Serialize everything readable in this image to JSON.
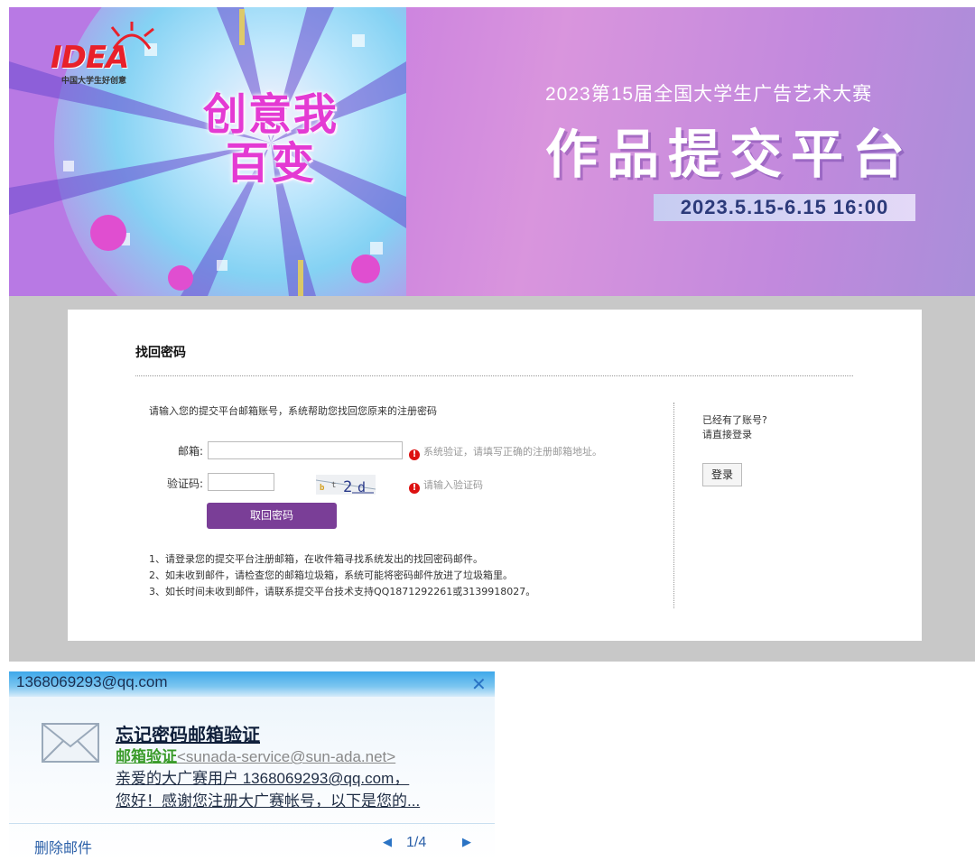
{
  "banner": {
    "logo_text": "IDEA",
    "logo_subtitle": "中国大学生好创意",
    "slogan_line1": "创意我",
    "slogan_line2": "百变",
    "contest_title": "2023第15届全国大学生广告艺术大赛",
    "platform_title": "作品提交平台",
    "date_range": "2023.5.15-6.15 16:00"
  },
  "reset": {
    "title": "找回密码",
    "intro": "请输入您的提交平台邮箱账号，系统帮助您找回您原来的注册密码",
    "email_label": "邮箱:",
    "email_hint": "系统验证，请填写正确的注册邮箱地址。",
    "captcha_label": "验证码:",
    "captcha_text": "b t 2 d",
    "captcha_hint": "请输入验证码",
    "submit_label": "取回密码",
    "notes": [
      "1、请登录您的提交平台注册邮箱，在收件箱寻找系统发出的找回密码邮件。",
      "2、如未收到邮件，请检查您的邮箱垃圾箱，系统可能将密码邮件放进了垃圾箱里。",
      "3、如长时间未收到邮件，请联系提交平台技术支持QQ1871292261或3139918027。"
    ],
    "side_question": "已经有了账号?",
    "side_prompt": "请直接登录",
    "login_label": "登录"
  },
  "popup": {
    "account": "1368069293@qq.com",
    "close_symbol": "✕",
    "subject": "忘记密码邮箱验证",
    "sender_name": "邮箱验证",
    "sender_address": "<sunada-service@sun-ada.net>",
    "preview_line1": "亲爱的大广赛用户 1368069293@qq.com，",
    "preview_line2": "您好！感谢您注册大广赛帐号，以下是您的...",
    "delete_label": "删除邮件",
    "pager_prev": "◀",
    "pager": "1/4",
    "pager_next": "▶"
  },
  "colors": {
    "brand_purple": "#7a3e97",
    "error_red": "#d11111",
    "sender_green": "#3a9b2a",
    "link_blue": "#2a5fa8"
  },
  "icons": {
    "error": "exclamation-circle-icon",
    "mail": "envelope-icon",
    "close": "close-icon",
    "prev": "triangle-left-icon",
    "next": "triangle-right-icon"
  }
}
